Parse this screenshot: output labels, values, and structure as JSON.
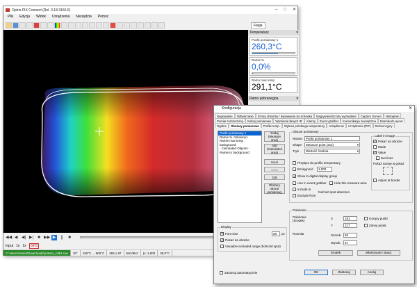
{
  "main": {
    "title": "Optris PIX Connect (Rel. 3.18.3150.0)",
    "menu": [
      "Plik",
      "Edycja",
      "Widok",
      "Urządzenia",
      "Narzędzia",
      "Pomoc"
    ],
    "flag_tab": "Flaga",
    "play_controls": [
      "◀◀",
      "◀",
      "◀|",
      "▶|",
      "■",
      "▶▶",
      "▶",
      "||",
      "■"
    ],
    "ctrl2": [
      "Input",
      "1x",
      "1x",
      "GPS"
    ],
    "status": [
      "C:\\Users\\tomek\\Downloads\\pratery_bilk2.ravi",
      "30°",
      "150°C ... 900°C",
      "284 x 87",
      "6Hz/6Hz",
      "(x: 1,000",
      "30,0°C"
    ]
  },
  "panel": {
    "header": "Temperatury",
    "items": [
      {
        "label": "Punkt pomiarowy 1",
        "value": "260,3°C"
      },
      {
        "label": "Ramie %",
        "value": "0,0%"
      },
      {
        "label": "Ramo max temp",
        "value": "291,1°C"
      }
    ],
    "footer_label": "Ramo pobranegoa"
  },
  "dialog": {
    "title": "Konfiguracja",
    "tabs_row1": [
      "Nagrywanie",
      "Odtwarzanie",
      "Zrzuty obrazów / kopiowanie do schowka",
      "Nagrywanie/zrzuty wyzwalane",
      "Capture Screen",
      "Histogram"
    ],
    "tabs_row2": [
      "Pomiar rozszerzony",
      "Kolory pomiarowe",
      "Wymiana danych IR",
      "Alarmy",
      "Event grabber",
      "Komunikacja zewnętrzna",
      "Extended Layout"
    ],
    "tabs_row3": [
      "Ogólne",
      "Obszary pomiarowe",
      "Profile temp.",
      "Wykres przebiegu temperatury",
      "Urządzenie",
      "Urządzenie (PIF)",
      "Referencyjny"
    ],
    "object_list": [
      "Punkt pomiarowy 1",
      "Ramie % <Ukowny>",
      "Ramie max temp",
      "background",
      "- Calculated Objects -",
      "Ramie to background"
    ],
    "side_buttons": [
      "Dodaj",
      "(Measure area)",
      "Add",
      "(Calculated area)",
      "Usuń",
      "Góra",
      "Dół",
      "Obszary obszar pomiarowy"
    ],
    "obszar_title": "Obszar pomiarowy",
    "nazwa_label": "Nazwa",
    "nazwa_value": "Punkt pomiarowy 1",
    "shape_label": "Shape",
    "shape_value": "Measure point (2x2)",
    "tryb_label": "Tryb",
    "tryb_value": "Wartość średnia",
    "label_group": "Label in image",
    "label_opts": [
      "Pokaż na obrazie",
      "Mode",
      "Value",
      "two lines"
    ],
    "place_label": "Pokaż nazwę w pokaż",
    "adjust_label": "Adjust at border",
    "checks": [
      "Przyłącz do profilu temperatury",
      "Emisyjność",
      "Show in digital display group",
      "Use in event grabber",
      "Hide this measure area",
      "Include in",
      "Exclude from"
    ],
    "emis_value": "1,000",
    "hotcold_label": "hot/cold spot detection",
    "display_title": "Display",
    "font_label": "Font size",
    "font_value": "28",
    "font_unit": "px",
    "display_checks": [
      "Pokaż na obrazie",
      "Visualize excluded range (hot/cold spot)"
    ],
    "pos_title": "Położenie",
    "pos_label": "Położenie (Środek)",
    "x_label": "X",
    "x_value": "181",
    "y_label": "Y",
    "y_value": "217",
    "goracy": "Gorący punkt",
    "zimny": "Zimny punkt",
    "rozmiar": "Rozmiar",
    "szer_label": "Szerok.",
    "szer_value": "55",
    "wys_label": "Wysok.",
    "wys_value": "37",
    "srodek_btn": "Środek",
    "wlasc_btn": "Właściwości stand.",
    "auto_label": "Zastosuj automatycznie",
    "ok": "OK",
    "apply": "Zastosuj",
    "cancel": "Anuluj"
  }
}
